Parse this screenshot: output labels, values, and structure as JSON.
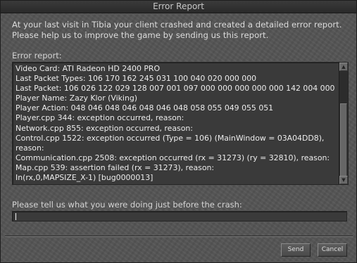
{
  "window": {
    "title": "Error Report"
  },
  "intro": {
    "text": "At your last visit in Tibia your client crashed and created a detailed error report.\nPlease help us to improve the game by sending us this report."
  },
  "report": {
    "label": "Error report:",
    "lines": [
      "Video Card: ATI Radeon HD 2400 PRO",
      "Last Packet Types: 106 170 162 245 031 100 040 020 000 000",
      "Last Packet: 106 026 122 029 128 007 001 097 000 000 000 000 000 142 004 000",
      "Player Name: Zazy Klor (Viking)",
      "Player Action: 048 046 048 046 048 046 048 058 055 049 055 051",
      "Player.cpp 344: exception occurred, reason:",
      "Network.cpp 855: exception occurred, reason:",
      "Control.cpp 1522: exception occurred (Type = 106) (MainWindow = 03A04DD8),",
      "reason:",
      "Communication.cpp 2508: exception occurred (rx = 31273) (ry = 32810), reason:",
      "Map.cpp 539: assertion failed (rx = 31273), reason:",
      "In(rx,0,MAPSIZE_X-1) [bug0000013]"
    ]
  },
  "crash_input": {
    "label": "Please tell us what you were doing just before the crash:",
    "value": ""
  },
  "buttons": {
    "send": "Send",
    "cancel": "Cancel"
  },
  "icons": {
    "scroll_up": "arrow-up-icon",
    "scroll_down": "arrow-down-icon"
  }
}
